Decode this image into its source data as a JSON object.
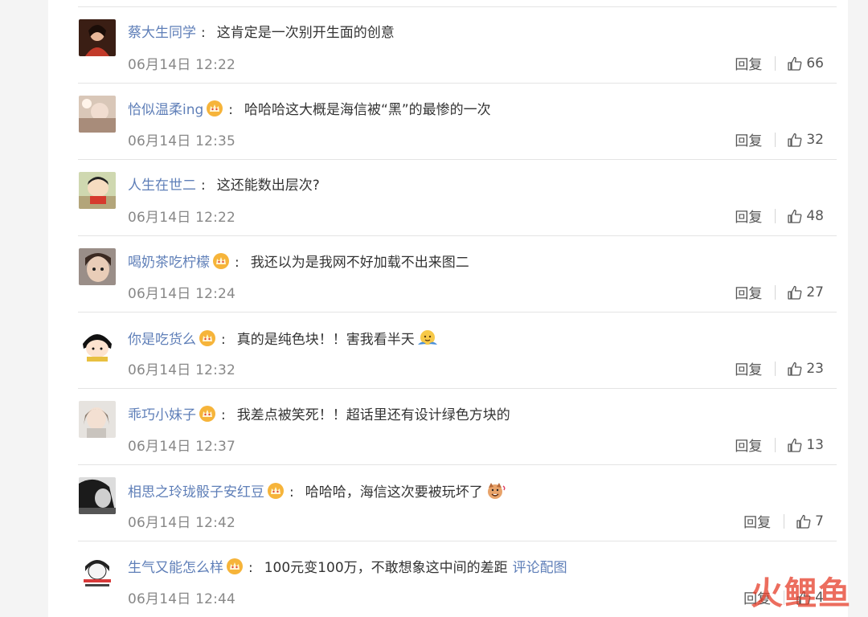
{
  "comments": [
    {
      "username": "蔡大生同学",
      "badge": false,
      "text": "这肯定是一次别开生面的创意",
      "time": "06月14日 12:22",
      "reply_label": "回复",
      "likes": "66"
    },
    {
      "username": "恰似温柔ing",
      "badge": true,
      "text": "哈哈哈这大概是海信被“黑”的最惨的一次",
      "time": "06月14日 12:35",
      "reply_label": "回复",
      "likes": "32"
    },
    {
      "username": "人生在世二",
      "badge": false,
      "text": "这还能数出层次?",
      "time": "06月14日 12:22",
      "reply_label": "回复",
      "likes": "48"
    },
    {
      "username": "喝奶茶吃柠檬",
      "badge": true,
      "text": "我还以为是我网不好加载不出来图二",
      "time": "06月14日 12:24",
      "reply_label": "回复",
      "likes": "27"
    },
    {
      "username": "你是吃货么",
      "badge": true,
      "text": "真的是纯色块！！害我看半天",
      "emoji": "hug-emoji",
      "time": "06月14日 12:32",
      "reply_label": "回复",
      "likes": "23"
    },
    {
      "username": "乖巧小妹子",
      "badge": true,
      "text": "我差点被笑死！！超话里还有设计绿色方块的",
      "time": "06月14日 12:37",
      "reply_label": "回复",
      "likes": "13"
    },
    {
      "username": "相思之玲珑骰子安红豆",
      "badge": true,
      "text": "哈哈哈，海信这次要被玩坏了",
      "emoji": "laugh-doge-emoji",
      "time": "06月14日 12:42",
      "reply_label": "回复",
      "likes": "7"
    },
    {
      "username": "生气又能怎么样",
      "badge": true,
      "text": "100元变100万，不敢想象这中间的差距",
      "link": "评论配图",
      "time": "06月14日 12:44",
      "reply_label": "回复",
      "likes": "4"
    }
  ],
  "watermark": "火鲤鱼",
  "colors": {
    "username": "#5f7fb8",
    "text": "#333333",
    "meta": "#888888",
    "divider": "#e4e4e4"
  }
}
